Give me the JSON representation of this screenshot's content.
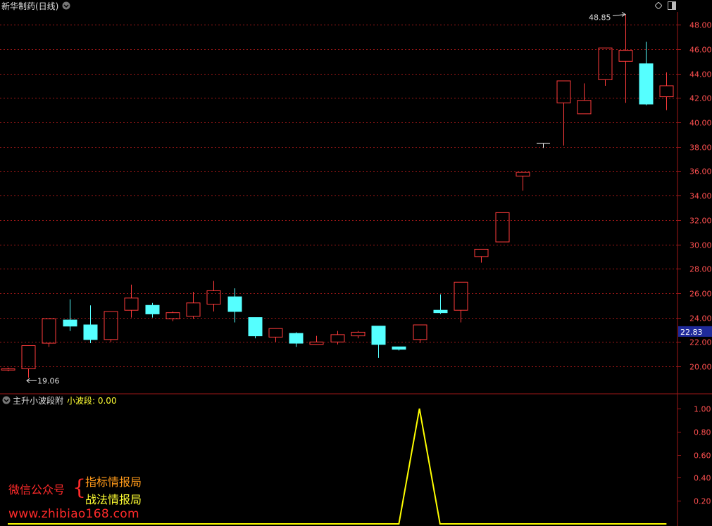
{
  "main_header": {
    "title": "新华制药(日线)"
  },
  "sub_header": {
    "indicator_name": "主升小波段附",
    "series_label": "小波段: 0.00"
  },
  "colors": {
    "bg": "#000000",
    "up": "#ff3b3b",
    "down": "#55ffff",
    "flat": "#ffffff",
    "grid": "#a01818",
    "axis_text": "#ff5050",
    "indicator_line": "#ffff00",
    "price_badge_bg": "#1f2a9a"
  },
  "current_price_label": "22.83",
  "watermark": {
    "line1": "微信公众号",
    "brace": "{",
    "line2": "指标情报局",
    "line3": "战法情报局",
    "url": "www.zhibiao168.com"
  },
  "chart_data": [
    {
      "type": "candlestick",
      "title": "新华制药(日线)",
      "ylim": [
        18.0,
        49.0
      ],
      "y_ticks": [
        "20.00",
        "22.00",
        "24.00",
        "26.00",
        "28.00",
        "30.00",
        "32.00",
        "34.00",
        "36.00",
        "38.00",
        "40.00",
        "42.00",
        "44.00",
        "46.00",
        "48.00"
      ],
      "grid": true,
      "annotations": [
        {
          "text": "48.85",
          "bar_index": 30,
          "value": 48.85,
          "kind": "high"
        },
        {
          "text": "19.06",
          "bar_index": 1,
          "value": 19.06,
          "kind": "low"
        }
      ],
      "candles": [
        {
          "o": 19.7,
          "h": 19.9,
          "l": 19.6,
          "c": 19.8
        },
        {
          "o": 19.8,
          "h": 21.7,
          "l": 19.06,
          "c": 21.7
        },
        {
          "o": 21.9,
          "h": 23.9,
          "l": 21.6,
          "c": 23.9
        },
        {
          "o": 23.8,
          "h": 25.5,
          "l": 22.9,
          "c": 23.3
        },
        {
          "o": 23.4,
          "h": 25.0,
          "l": 21.9,
          "c": 22.2
        },
        {
          "o": 22.2,
          "h": 24.5,
          "l": 22.0,
          "c": 24.5
        },
        {
          "o": 24.6,
          "h": 26.7,
          "l": 24.0,
          "c": 25.6
        },
        {
          "o": 25.0,
          "h": 25.2,
          "l": 24.0,
          "c": 24.3
        },
        {
          "o": 23.9,
          "h": 24.5,
          "l": 23.7,
          "c": 24.4
        },
        {
          "o": 24.1,
          "h": 26.1,
          "l": 23.9,
          "c": 25.2
        },
        {
          "o": 25.1,
          "h": 27.0,
          "l": 24.5,
          "c": 26.2
        },
        {
          "o": 25.7,
          "h": 26.4,
          "l": 23.6,
          "c": 24.5
        },
        {
          "o": 24.0,
          "h": 24.0,
          "l": 22.3,
          "c": 22.5
        },
        {
          "o": 22.4,
          "h": 23.1,
          "l": 22.0,
          "c": 23.1
        },
        {
          "o": 22.7,
          "h": 22.8,
          "l": 21.6,
          "c": 21.9
        },
        {
          "o": 21.8,
          "h": 22.5,
          "l": 21.8,
          "c": 22.0
        },
        {
          "o": 22.0,
          "h": 22.9,
          "l": 21.8,
          "c": 22.6
        },
        {
          "o": 22.5,
          "h": 22.9,
          "l": 22.3,
          "c": 22.8
        },
        {
          "o": 23.3,
          "h": 23.3,
          "l": 20.7,
          "c": 21.8
        },
        {
          "o": 21.6,
          "h": 21.6,
          "l": 21.3,
          "c": 21.4
        },
        {
          "o": 22.2,
          "h": 23.4,
          "l": 21.9,
          "c": 23.4
        },
        {
          "o": 24.6,
          "h": 25.9,
          "l": 24.3,
          "c": 24.4
        },
        {
          "o": 24.6,
          "h": 26.9,
          "l": 23.6,
          "c": 26.9
        },
        {
          "o": 29.0,
          "h": 29.6,
          "l": 28.5,
          "c": 29.6
        },
        {
          "o": 30.2,
          "h": 32.6,
          "l": 30.2,
          "c": 32.6
        },
        {
          "o": 35.6,
          "h": 35.9,
          "l": 34.4,
          "c": 35.9
        },
        {
          "o": 38.3,
          "h": 38.3,
          "l": 37.9,
          "c": 38.3
        },
        {
          "o": 41.6,
          "h": 43.4,
          "l": 38.1,
          "c": 43.4
        },
        {
          "o": 40.7,
          "h": 43.2,
          "l": 40.7,
          "c": 41.8
        },
        {
          "o": 43.5,
          "h": 46.1,
          "l": 43.0,
          "c": 46.1
        },
        {
          "o": 45.0,
          "h": 48.85,
          "l": 41.6,
          "c": 45.9
        },
        {
          "o": 44.8,
          "h": 46.6,
          "l": 41.4,
          "c": 41.5
        },
        {
          "o": 42.1,
          "h": 44.1,
          "l": 41.0,
          "c": 43.0
        }
      ]
    },
    {
      "type": "line",
      "title": "主升小波段附",
      "series": [
        {
          "name": "小波段",
          "values": [
            0,
            0,
            0,
            0,
            0,
            0,
            0,
            0,
            0,
            0,
            0,
            0,
            0,
            0,
            0,
            0,
            0,
            0,
            0,
            0,
            1,
            0,
            0,
            0,
            0,
            0,
            0,
            0,
            0,
            0,
            0,
            0,
            0
          ]
        }
      ],
      "ylim": [
        0.0,
        1.0
      ],
      "y_ticks": [
        "0.20",
        "0.40",
        "0.60",
        "0.80",
        "1.00"
      ]
    }
  ]
}
